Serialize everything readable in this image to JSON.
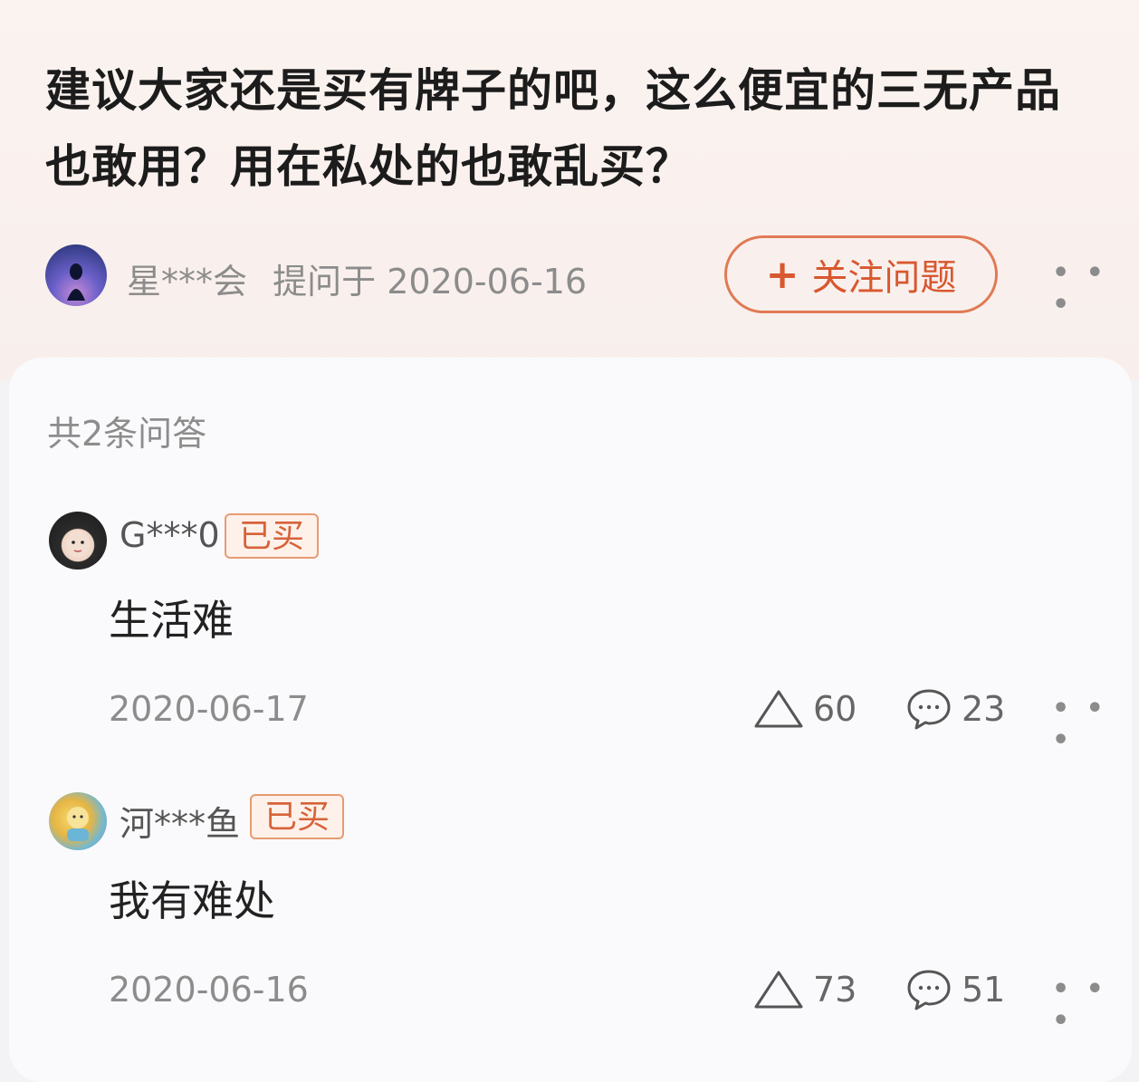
{
  "question": {
    "title": "建议大家还是买有牌子的吧，这么便宜的三无产品也敢用？用在私处的也敢乱买？",
    "asker": "星***会",
    "asked_label": "提问于",
    "asked_date": "2020-06-16",
    "follow_label": "关注问题",
    "follow_icon": "plus-icon",
    "more_label": "• • •"
  },
  "answers_count_label": "共2条问答",
  "answers": [
    {
      "name": "G***0",
      "badge": "已买",
      "text": "生活难",
      "date": "2020-06-17",
      "likes": "60",
      "comments": "23",
      "more_label": "• • •"
    },
    {
      "name": "河***鱼",
      "badge": "已买",
      "text": "我有难处",
      "date": "2020-06-16",
      "likes": "73",
      "comments": "51",
      "more_label": "• • •"
    }
  ],
  "colors": {
    "accent": "#d8582f",
    "badge_border": "#e89a72",
    "muted_text": "#8c8c8c"
  }
}
